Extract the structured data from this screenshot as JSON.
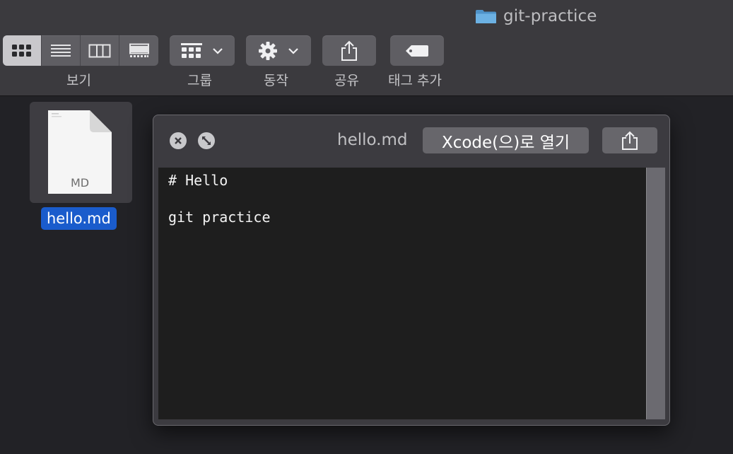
{
  "window": {
    "title": "git-practice",
    "folder_icon": "folder-icon"
  },
  "toolbar": {
    "view_label": "보기",
    "group_label": "그룹",
    "action_label": "동작",
    "share_label": "공유",
    "tag_label": "태그 추가"
  },
  "files": [
    {
      "name": "hello.md",
      "type_label": "MD",
      "selected": true
    }
  ],
  "quicklook": {
    "title": "hello.md",
    "open_button": "Xcode(으)로 열기",
    "content": "# Hello\n\ngit practice"
  },
  "colors": {
    "selection": "#1a5ccc",
    "folder": "#5ea4d8"
  }
}
